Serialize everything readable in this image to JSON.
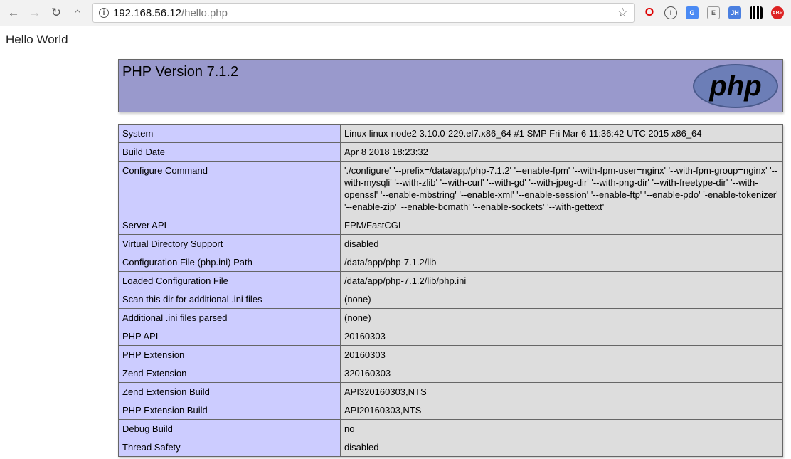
{
  "browser": {
    "url_host": "192.168.56.12",
    "url_path": "/hello.php",
    "extensions": [
      "opera-icon",
      "info-icon",
      "translate-icon",
      "E",
      "JH",
      "qr-icon",
      "ABP"
    ]
  },
  "page": {
    "hello": "Hello World",
    "title": "PHP Version 7.1.2",
    "logo_text": "php"
  },
  "rows": [
    {
      "k": "System",
      "v": "Linux linux-node2 3.10.0-229.el7.x86_64 #1 SMP Fri Mar 6 11:36:42 UTC 2015 x86_64"
    },
    {
      "k": "Build Date",
      "v": "Apr 8 2018 18:23:32"
    },
    {
      "k": "Configure Command",
      "v": "'./configure' '--prefix=/data/app/php-7.1.2' '--enable-fpm' '--with-fpm-user=nginx' '--with-fpm-group=nginx' '--with-mysqli' '--with-zlib' '--with-curl' '--with-gd' '--with-jpeg-dir' '--with-png-dir' '--with-freetype-dir' '--with-openssl' '--enable-mbstring' '--enable-xml' '--enable-session' '--enable-ftp' '--enable-pdo' '-enable-tokenizer' '--enable-zip' '--enable-bcmath' '--enable-sockets' '--with-gettext'"
    },
    {
      "k": "Server API",
      "v": "FPM/FastCGI"
    },
    {
      "k": "Virtual Directory Support",
      "v": "disabled"
    },
    {
      "k": "Configuration File (php.ini) Path",
      "v": "/data/app/php-7.1.2/lib"
    },
    {
      "k": "Loaded Configuration File",
      "v": "/data/app/php-7.1.2/lib/php.ini"
    },
    {
      "k": "Scan this dir for additional .ini files",
      "v": "(none)"
    },
    {
      "k": "Additional .ini files parsed",
      "v": "(none)"
    },
    {
      "k": "PHP API",
      "v": "20160303"
    },
    {
      "k": "PHP Extension",
      "v": "20160303"
    },
    {
      "k": "Zend Extension",
      "v": "320160303"
    },
    {
      "k": "Zend Extension Build",
      "v": "API320160303,NTS"
    },
    {
      "k": "PHP Extension Build",
      "v": "API20160303,NTS"
    },
    {
      "k": "Debug Build",
      "v": "no"
    },
    {
      "k": "Thread Safety",
      "v": "disabled"
    }
  ]
}
